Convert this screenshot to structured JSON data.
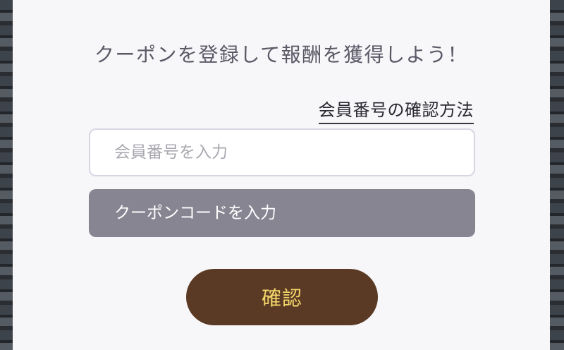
{
  "dialog": {
    "title": "クーポンを登録して報酬を獲得しよう！",
    "help_link": "会員番号の確認方法",
    "member_input": {
      "placeholder": "会員番号を入力",
      "value": ""
    },
    "coupon_input": {
      "placeholder": "クーポンコードを入力",
      "value": ""
    },
    "confirm_button": "確認"
  },
  "colors": {
    "dialog_bg": "#f7f6f9",
    "coupon_field_bg": "#878592",
    "confirm_button_bg": "#5a3a24",
    "confirm_button_text": "#f4d76a"
  }
}
